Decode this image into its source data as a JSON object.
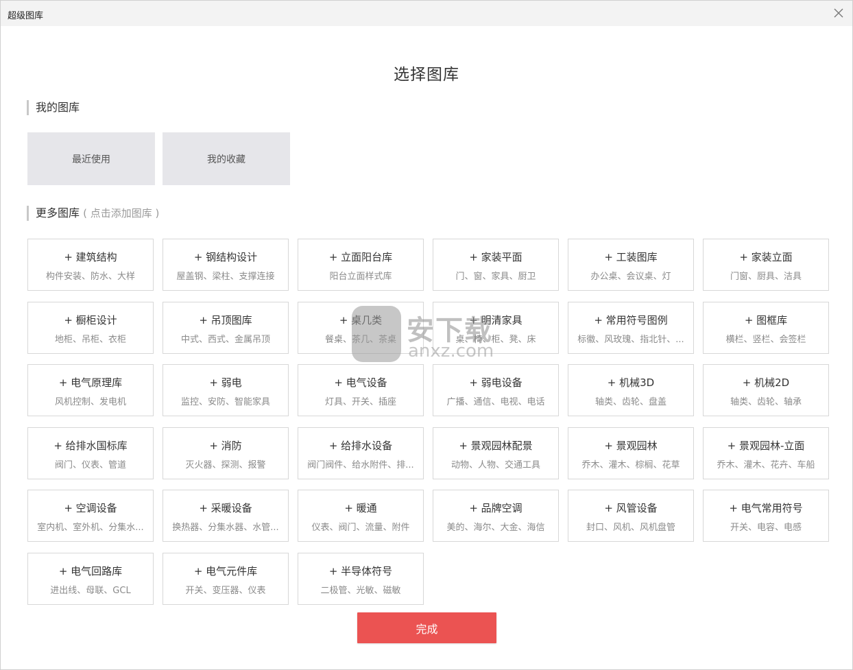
{
  "window": {
    "title": "超级图库",
    "close_icon": "close-icon"
  },
  "main_title": "选择图库",
  "my_library": {
    "heading": "我的图库",
    "items": [
      {
        "label": "最近使用"
      },
      {
        "label": "我的收藏"
      }
    ]
  },
  "more_library": {
    "heading": "更多图库",
    "hint": "( 点击添加图库 )",
    "cards": [
      {
        "title": "+ 建筑结构",
        "sub": "构件安装、防水、大样"
      },
      {
        "title": "+ 钢结构设计",
        "sub": "屋盖钢、梁柱、支撑连接"
      },
      {
        "title": "+ 立面阳台库",
        "sub": "阳台立面样式库"
      },
      {
        "title": "+ 家装平面",
        "sub": "门、窗、家具、厨卫"
      },
      {
        "title": "+ 工装图库",
        "sub": "办公桌、会议桌、灯"
      },
      {
        "title": "+ 家装立面",
        "sub": "门窗、厨具、洁具"
      },
      {
        "title": "+ 橱柜设计",
        "sub": "地柜、吊柜、衣柜"
      },
      {
        "title": "+ 吊顶图库",
        "sub": "中式、西式、金属吊顶"
      },
      {
        "title": "+ 桌几类",
        "sub": "餐桌、茶几、茶桌"
      },
      {
        "title": "+ 明清家具",
        "sub": "桌、椅、柜、凳、床"
      },
      {
        "title": "+ 常用符号图例",
        "sub": "标徽、风玫瑰、指北针、..."
      },
      {
        "title": "+ 图框库",
        "sub": "横栏、竖栏、会签栏"
      },
      {
        "title": "+ 电气原理库",
        "sub": "风机控制、发电机"
      },
      {
        "title": "+ 弱电",
        "sub": "监控、安防、智能家具"
      },
      {
        "title": "+ 电气设备",
        "sub": "灯具、开关、插座"
      },
      {
        "title": "+ 弱电设备",
        "sub": "广播、通信、电视、电话"
      },
      {
        "title": "+ 机械3D",
        "sub": "轴类、齿轮、盘盖"
      },
      {
        "title": "+ 机械2D",
        "sub": "轴类、齿轮、轴承"
      },
      {
        "title": "+ 给排水国标库",
        "sub": "阀门、仪表、管道"
      },
      {
        "title": "+ 消防",
        "sub": "灭火器、探测、报警"
      },
      {
        "title": "+ 给排水设备",
        "sub": "阀门阀件、给水附件、排..."
      },
      {
        "title": "+ 景观园林配景",
        "sub": "动物、人物、交通工具"
      },
      {
        "title": "+ 景观园林",
        "sub": "乔木、灌木、棕榈、花草"
      },
      {
        "title": "+ 景观园林-立面",
        "sub": "乔木、灌木、花卉、车船"
      },
      {
        "title": "+ 空调设备",
        "sub": "室内机、室外机、分集水..."
      },
      {
        "title": "+ 采暖设备",
        "sub": "换热器、分集水器、水管..."
      },
      {
        "title": "+ 暖通",
        "sub": "仪表、阀门、流量、附件"
      },
      {
        "title": "+ 品牌空调",
        "sub": "美的、海尔、大金、海信"
      },
      {
        "title": "+ 风管设备",
        "sub": "封口、风机、风机盘管"
      },
      {
        "title": "+ 电气常用符号",
        "sub": "开关、电容、电感"
      },
      {
        "title": "+ 电气回路库",
        "sub": "进出线、母联、GCL"
      },
      {
        "title": "+ 电气元件库",
        "sub": "开关、变压器、仪表"
      },
      {
        "title": "+ 半导体符号",
        "sub": "二极管、光敏、磁敏"
      }
    ]
  },
  "done_button": "完成",
  "watermark": {
    "big": "安下载",
    "small": "anxz.com",
    "icon": "shield-logo-icon"
  }
}
